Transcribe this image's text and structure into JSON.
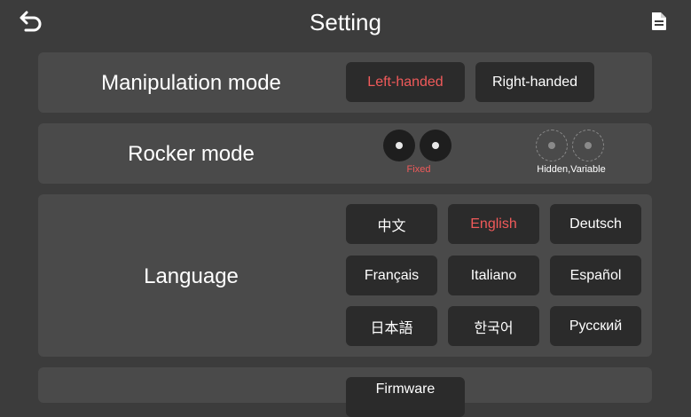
{
  "header": {
    "title": "Setting",
    "back_icon": "back-arrow-icon",
    "doc_icon": "document-icon"
  },
  "manipulation": {
    "label": "Manipulation mode",
    "options": [
      "Left-handed",
      "Right-handed"
    ],
    "selected": "Left-handed"
  },
  "rocker": {
    "label": "Rocker mode",
    "options": [
      "Fixed",
      "Hidden,Variable"
    ],
    "selected": "Fixed"
  },
  "language": {
    "label": "Language",
    "options": [
      "中文",
      "English",
      "Deutsch",
      "Français",
      "Italiano",
      "Español",
      "日本語",
      "한국어",
      "Русский"
    ],
    "selected": "English"
  },
  "firmware": {
    "button_label": "Firmware"
  },
  "colors": {
    "background": "#3c3c3c",
    "panel": "#4a4a4a",
    "button": "#2b2b2b",
    "accent": "#f05a5a"
  }
}
